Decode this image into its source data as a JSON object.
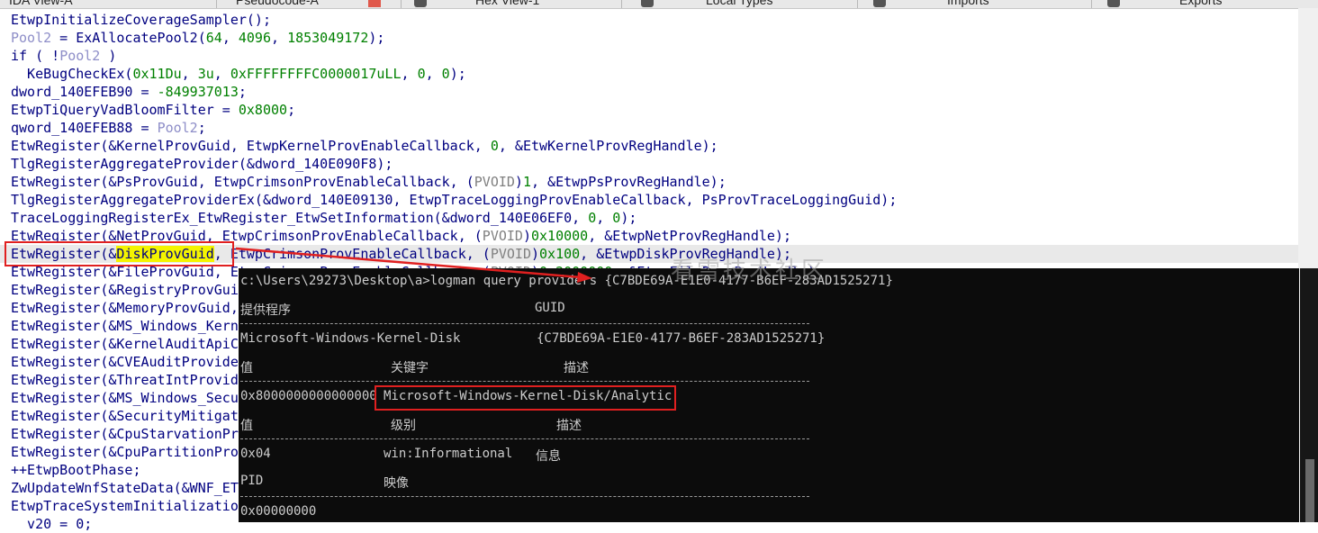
{
  "tabs": [
    "IDA View-A",
    "Pseudocode-A",
    "Hex View-1",
    "Local Types",
    "Imports",
    "Exports"
  ],
  "code_lines": [
    [
      {
        "t": "EtwpInitializeCoverageSampler();",
        "c": ""
      }
    ],
    [
      {
        "t": "Pool2",
        "c": "lvar"
      },
      {
        "t": " = ExAllocatePool2(",
        "c": ""
      },
      {
        "t": "64",
        "c": "num"
      },
      {
        "t": ", ",
        "c": ""
      },
      {
        "t": "4096",
        "c": "num"
      },
      {
        "t": ", ",
        "c": ""
      },
      {
        "t": "1853049172",
        "c": "num"
      },
      {
        "t": ");",
        "c": ""
      }
    ],
    [
      {
        "t": "if ( !",
        "c": ""
      },
      {
        "t": "Pool2",
        "c": "lvar"
      },
      {
        "t": " )",
        "c": ""
      }
    ],
    [
      {
        "t": "  KeBugCheckEx(",
        "c": ""
      },
      {
        "t": "0x11Du",
        "c": "num"
      },
      {
        "t": ", ",
        "c": ""
      },
      {
        "t": "3u",
        "c": "num"
      },
      {
        "t": ", ",
        "c": ""
      },
      {
        "t": "0xFFFFFFFFC0000017uLL",
        "c": "num"
      },
      {
        "t": ", ",
        "c": ""
      },
      {
        "t": "0",
        "c": "num"
      },
      {
        "t": ", ",
        "c": ""
      },
      {
        "t": "0",
        "c": "num"
      },
      {
        "t": ");",
        "c": ""
      }
    ],
    [
      {
        "t": "dword_140EFEB90 = ",
        "c": ""
      },
      {
        "t": "-849937013",
        "c": "num"
      },
      {
        "t": ";",
        "c": ""
      }
    ],
    [
      {
        "t": "EtwpTiQueryVadBloomFilter = ",
        "c": ""
      },
      {
        "t": "0x8000",
        "c": "num"
      },
      {
        "t": ";",
        "c": ""
      }
    ],
    [
      {
        "t": "qword_140EFEB88 = ",
        "c": ""
      },
      {
        "t": "Pool2",
        "c": "lvar"
      },
      {
        "t": ";",
        "c": ""
      }
    ],
    [
      {
        "t": "EtwRegister(&KernelProvGuid, EtwpKernelProvEnableCallback, ",
        "c": ""
      },
      {
        "t": "0",
        "c": "num"
      },
      {
        "t": ", &EtwKernelProvRegHandle);",
        "c": ""
      }
    ],
    [
      {
        "t": "TlgRegisterAggregateProvider(&dword_140E090F8);",
        "c": ""
      }
    ],
    [
      {
        "t": "EtwRegister(&PsProvGuid, EtwpCrimsonProvEnableCallback, (",
        "c": ""
      },
      {
        "t": "PVOID",
        "c": "gray"
      },
      {
        "t": ")",
        "c": ""
      },
      {
        "t": "1",
        "c": "num"
      },
      {
        "t": ", &EtwpPsProvRegHandle);",
        "c": ""
      }
    ],
    [
      {
        "t": "TlgRegisterAggregateProviderEx(&dword_140E09130, EtwpTraceLoggingProvEnableCallback, PsProvTraceLoggingGuid);",
        "c": ""
      }
    ],
    [
      {
        "t": "TraceLoggingRegisterEx_EtwRegister_EtwSetInformation(&dword_140E06EF0, ",
        "c": ""
      },
      {
        "t": "0",
        "c": "num"
      },
      {
        "t": ", ",
        "c": ""
      },
      {
        "t": "0",
        "c": "num"
      },
      {
        "t": ");",
        "c": ""
      }
    ],
    [
      {
        "t": "EtwRegister(&NetProvGuid, EtwpCrimsonProvEnableCallback, (",
        "c": ""
      },
      {
        "t": "PVOID",
        "c": "gray"
      },
      {
        "t": ")",
        "c": ""
      },
      {
        "t": "0x10000",
        "c": "num"
      },
      {
        "t": ", &EtwpNetProvRegHandle);",
        "c": ""
      }
    ],
    [
      {
        "t": "EtwRegister(&",
        "c": ""
      },
      {
        "t": "DiskProvGuid",
        "c": "yellow"
      },
      {
        "t": ", EtwpCrimsonProvEnableCallback, (",
        "c": ""
      },
      {
        "t": "PVOID",
        "c": "gray"
      },
      {
        "t": ")",
        "c": ""
      },
      {
        "t": "0x100",
        "c": "num"
      },
      {
        "t": ", &EtwpDiskProvRegHandle);",
        "c": ""
      }
    ],
    [
      {
        "t": "EtwRegister(&FileProvGuid, EtwpCrimsonProvEnableCallback, (",
        "c": ""
      },
      {
        "t": "PVOID",
        "c": "gray"
      },
      {
        "t": ")",
        "c": ""
      },
      {
        "t": "0x2000000",
        "c": "num"
      },
      {
        "t": ", &EtwpFileProvRegHandle);",
        "c": ""
      }
    ],
    [
      {
        "t": "EtwRegister(&RegistryProvGuid",
        "c": ""
      }
    ],
    [
      {
        "t": "EtwRegister(&MemoryProvGuid,",
        "c": ""
      }
    ],
    [
      {
        "t": "EtwRegister(&MS_Windows_Kerne",
        "c": ""
      }
    ],
    [
      {
        "t": "EtwRegister(&KernelAuditApiCa",
        "c": ""
      }
    ],
    [
      {
        "t": "EtwRegister(&CVEAuditProvider",
        "c": ""
      }
    ],
    [
      {
        "t": "EtwRegister(&ThreatIntProvide",
        "c": ""
      }
    ],
    [
      {
        "t": "EtwRegister(&MS_Windows_Secur",
        "c": ""
      }
    ],
    [
      {
        "t": "EtwRegister(&SecurityMitigati",
        "c": ""
      }
    ],
    [
      {
        "t": "EtwRegister(&CpuStarvationPro",
        "c": ""
      }
    ],
    [
      {
        "t": "EtwRegister(&CpuPartitionProv",
        "c": ""
      }
    ],
    [
      {
        "t": "++EtwpBootPhase;",
        "c": ""
      }
    ],
    [
      {
        "t": "ZwUpdateWnfStateData(&WNF_ETW",
        "c": ""
      }
    ],
    [
      {
        "t": "EtwpTraceSystemInitialization",
        "c": ""
      }
    ],
    [
      {
        "t": "  v20 = 0;",
        "c": ""
      }
    ]
  ],
  "console": {
    "command": "c:\\Users\\29273\\Desktop\\a>logman query providers {C7BDE69A-E1E0-4177-B6EF-283AD1525271}",
    "header_provider": "提供程序",
    "header_guid": "GUID",
    "provider_name": "Microsoft-Windows-Kernel-Disk",
    "provider_guid": "{C7BDE69A-E1E0-4177-B6EF-283AD1525271}",
    "h_value": "值",
    "h_keyword": "关键字",
    "h_desc": "描述",
    "kw_value": "0x8000000000000000",
    "kw_name": "Microsoft-Windows-Kernel-Disk/Analytic",
    "h_value2": "值",
    "h_level": "级别",
    "h_desc2": "描述",
    "lv_value": "0x04",
    "lv_name": "win:Informational",
    "lv_desc": "信息",
    "h_pid": "PID",
    "h_image": "映像",
    "pid_value": "0x00000000"
  },
  "watermark": "看雪技术社区",
  "colors": {
    "code": "#000080",
    "number": "#008000",
    "local_var": "#8e8ec8",
    "highlight": "#f4f400",
    "annotation": "#e02020",
    "console_bg": "#0c0c0c"
  }
}
